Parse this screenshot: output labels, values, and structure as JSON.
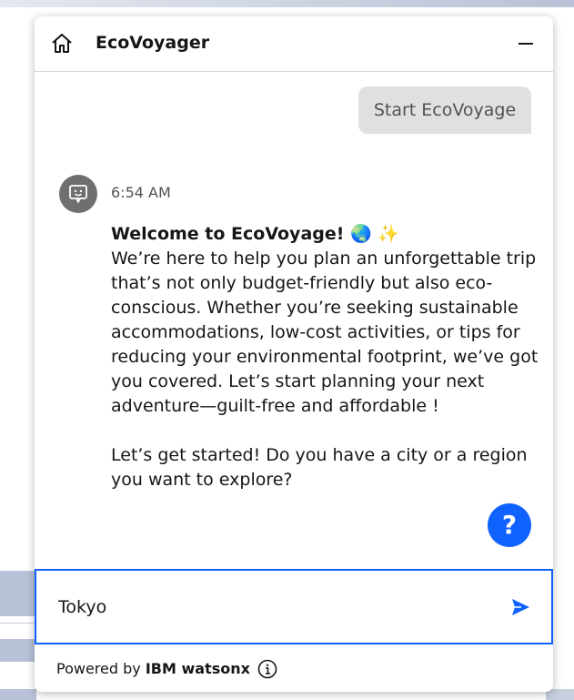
{
  "header": {
    "title": "EcoVoyager",
    "home_icon": "home-icon",
    "minimize_icon": "minimize-icon"
  },
  "conversation": {
    "user_message": "Start EcoVoyage",
    "bot_avatar_icon": "chat-bot-icon",
    "timestamp": "6:54 AM",
    "bot_message": {
      "heading": "Welcome to EcoVoyage! 🌏 ✨",
      "body": "We’re here to help you plan an unforgettable trip that’s not only budget-friendly but also eco-conscious. Whether you’re seeking sustainable accommodations, low-cost activities, or tips for reducing your environmental footprint, we’ve got you covered. Let’s start planning your next adventure—guilt-free and affordable !",
      "follow_up": "Let’s get started! Do you have a city or a region you want to explore?"
    }
  },
  "help_button": {
    "label": "?"
  },
  "composer": {
    "value": "Tokyo",
    "send_icon": "send-icon"
  },
  "footer": {
    "powered_by": "Powered by",
    "brand": "IBM watsonx",
    "info_icon": "info-icon"
  },
  "colors": {
    "accent": "#0f62fe",
    "user_bubble": "#e0e0e0",
    "avatar": "#6f6f6f"
  }
}
